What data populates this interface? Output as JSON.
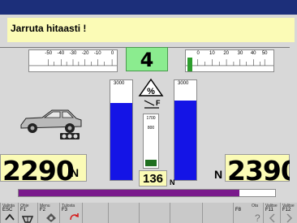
{
  "message": "Jarruta hitaasti !",
  "center_value": "4",
  "left_scale": {
    "labels": [
      "-50",
      "-40",
      "-30",
      "-20",
      "-10",
      "0"
    ]
  },
  "right_scale": {
    "labels": [
      "0",
      "10",
      "20",
      "30",
      "40",
      "50"
    ]
  },
  "left_bar": {
    "label": "3000",
    "fill_fraction": 0.77
  },
  "right_bar": {
    "label": "3000",
    "fill_fraction": 0.8
  },
  "tube": {
    "top_label": "1700",
    "mid_label": "800",
    "fill_fraction": 0.1
  },
  "left_value": {
    "number": "2290",
    "unit": "N"
  },
  "right_value": {
    "number": "2390",
    "unit": "N"
  },
  "center_small_value": {
    "number": "136",
    "unit": "N"
  },
  "progress_fraction": 0.86,
  "fkeys": [
    {
      "key": "ESC",
      "sub": "",
      "top": "Valinta",
      "icon": "home-icon"
    },
    {
      "key": "F1",
      "sub": "",
      "top": "Ohje",
      "icon": "lift-icon"
    },
    {
      "key": "F2",
      "sub": "",
      "top": "Menu",
      "icon": "gear-icon"
    },
    {
      "key": "F3",
      "sub": "",
      "top": "Tulosta",
      "icon": "arrows-icon"
    },
    {
      "key": "",
      "sub": "",
      "top": "",
      "icon": ""
    },
    {
      "key": "",
      "sub": "",
      "top": "",
      "icon": ""
    },
    {
      "key": "",
      "sub": "",
      "top": "",
      "icon": ""
    },
    {
      "key": "",
      "sub": "",
      "top": "",
      "icon": ""
    },
    {
      "key": "F8",
      "sub": "",
      "top": "Ota",
      "icon": "question-icon"
    },
    {
      "key": "F11",
      "sub": "",
      "top": "Valitse",
      "icon": "prev-icon"
    },
    {
      "key": "F12",
      "sub": "",
      "top": "Valitse",
      "icon": "next-icon"
    }
  ],
  "colors": {
    "header_bg": "#1c2f7a",
    "panel_bg": "#d8d8d8",
    "message_bg": "#fbfbb6",
    "bar_fill": "#1414e6",
    "center_bg": "#8bec8f",
    "progress_fill": "#7a1a8c"
  }
}
